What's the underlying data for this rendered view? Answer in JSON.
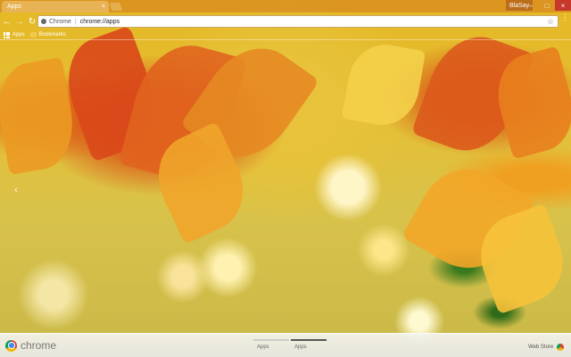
{
  "window": {
    "tab_title": "Apps",
    "profile_name": "BlaSay",
    "controls": [
      "–",
      "□",
      "×"
    ]
  },
  "toolbar": {
    "back_icon": "back-arrow-icon",
    "forward_icon": "forward-arrow-icon",
    "reload_icon": "reload-icon",
    "omnibox": {
      "chip_label": "Chrome",
      "url": "chrome://apps"
    }
  },
  "bookmarks": {
    "apps_label": "Apps",
    "bookmarks_label": "Bookmarks"
  },
  "bottom_bar": {
    "brand": "chrome",
    "pages": [
      "Apps",
      "Apps"
    ],
    "web_store_label": "Web Store"
  },
  "colors": {
    "accent_orange": "#e07a1a",
    "close_red": "#c8382a",
    "bar_bg": "#efefea"
  }
}
